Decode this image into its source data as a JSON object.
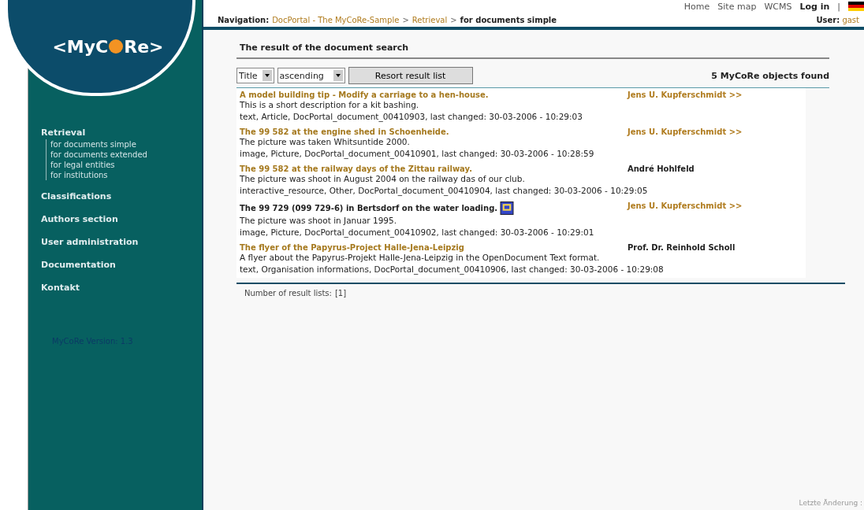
{
  "logo": {
    "text_before": "<MyC",
    "text_after": "Re>"
  },
  "top_links": [
    {
      "label": "Home",
      "bold": false
    },
    {
      "label": "Site map",
      "bold": false
    },
    {
      "label": "WCMS",
      "bold": false
    },
    {
      "label": "Log in",
      "bold": true
    }
  ],
  "separator": "|",
  "breadcrumb": {
    "label": "Navigation:",
    "items": [
      {
        "label": "DocPortal - The MyCoRe-Sample",
        "current": false
      },
      {
        "label": "Retrieval",
        "current": false
      },
      {
        "label": "for documents simple",
        "current": true
      }
    ],
    "separator": ">"
  },
  "user": {
    "label": "User:",
    "name": "gast"
  },
  "sidebar": {
    "items": [
      {
        "label": "Retrieval",
        "children": [
          {
            "label": "for documents simple"
          },
          {
            "label": "for documents extended"
          },
          {
            "label": "for legal entities"
          },
          {
            "label": "for institutions"
          }
        ]
      },
      {
        "label": "Classifications"
      },
      {
        "label": "Authors section"
      },
      {
        "label": "User administration"
      },
      {
        "label": "Documentation"
      },
      {
        "label": "Kontakt"
      }
    ],
    "version": "MyCoRe Version: 1.3"
  },
  "page_title": "The result of the document search",
  "sort": {
    "field": "Title",
    "order": "ascending",
    "button": "Resort result list"
  },
  "found": "5 MyCoRe objects found",
  "results": [
    {
      "title": "A model building tip - Modify a carriage to a hen-house.",
      "visited": false,
      "author": "Jens U. Kupferschmidt >>",
      "author_linked": true,
      "has_icon": false,
      "description": "This is a short description for a kit bashing.",
      "meta": "text, Article, DocPortal_document_00410903, last changed: 30-03-2006 - 10:29:03"
    },
    {
      "title": "The 99 582 at the engine shed in Schoenheide.",
      "visited": false,
      "author": "Jens U. Kupferschmidt >>",
      "author_linked": true,
      "has_icon": false,
      "description": "The picture was taken Whitsuntide 2000.",
      "meta": "image, Picture, DocPortal_document_00410901, last changed: 30-03-2006 - 10:28:59"
    },
    {
      "title": "The 99 582 at the railway days of the Zittau railway.",
      "visited": false,
      "author": "André Hohlfeld",
      "author_linked": false,
      "has_icon": false,
      "description": "The picture was shoot in August 2004 on the railway das of our club.",
      "meta": "interactive_resource, Other, DocPortal_document_00410904, last changed: 30-03-2006 - 10:29:05"
    },
    {
      "title": "The 99 729 (099 729-6) in Bertsdorf on the water loading.",
      "visited": true,
      "author": "Jens U. Kupferschmidt >>",
      "author_linked": true,
      "has_icon": true,
      "description": "The picture was shoot in Januar 1995.",
      "meta": "image, Picture, DocPortal_document_00410902, last changed: 30-03-2006 - 10:29:01"
    },
    {
      "title": "The flyer of the Papyrus-Project Halle-Jena-Leipzig",
      "visited": false,
      "author": "Prof. Dr. Reinhold Scholl",
      "author_linked": false,
      "has_icon": false,
      "description": "A flyer about the Papyrus-Projekt Halle-Jena-Leipzig in the OpenDocument Text format.",
      "meta": "text, Organisation informations, DocPortal_document_00410906, last changed: 30-03-2006 - 10:29:08"
    }
  ],
  "result_lists": {
    "label": "Number of result lists:",
    "pages": "[1]"
  },
  "footer": "Letzte Änderung :"
}
